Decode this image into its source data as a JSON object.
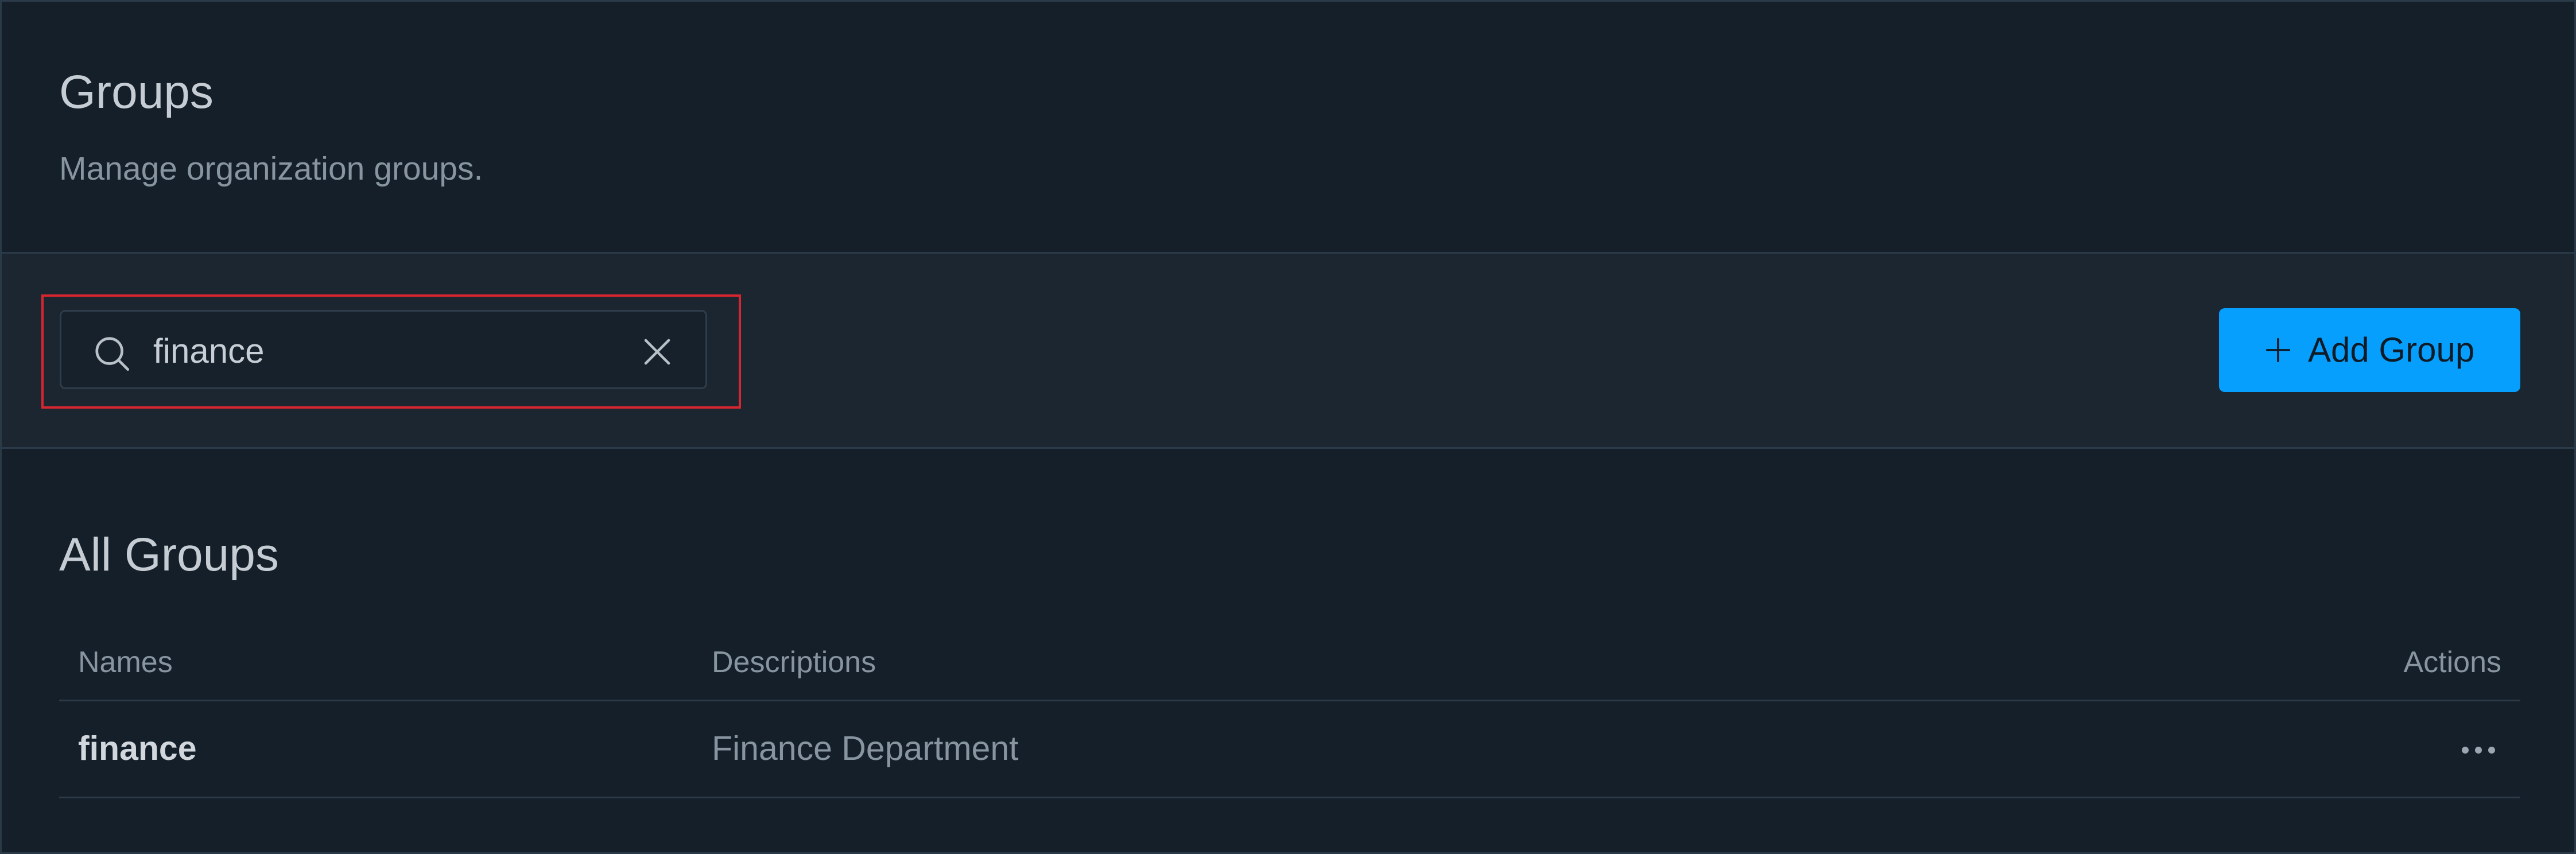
{
  "header": {
    "title": "Groups",
    "subtitle": "Manage organization groups."
  },
  "toolbar": {
    "search": {
      "value": "finance",
      "icon": "search-icon",
      "clear_icon": "close-icon"
    },
    "add_button": {
      "label": "Add Group",
      "icon": "plus-icon",
      "color": "#079ffd"
    },
    "highlight_color": "#d7262f"
  },
  "groups": {
    "section_title": "All Groups",
    "columns": {
      "names": "Names",
      "descriptions": "Descriptions",
      "actions": "Actions"
    },
    "rows": [
      {
        "name": "finance",
        "description": "Finance Department",
        "actions_icon": "more-horizontal-icon"
      }
    ]
  },
  "colors": {
    "background": "#151f29",
    "toolbar_background": "#1b2631",
    "border": "#2b3a48"
  }
}
